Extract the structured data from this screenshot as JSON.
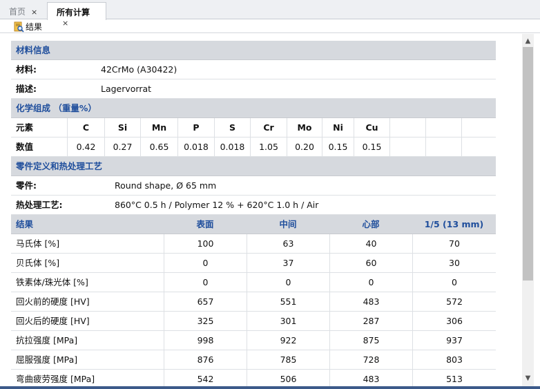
{
  "tabs": [
    {
      "label": "首页",
      "close": "×"
    },
    {
      "label": "所有计算",
      "close": "×"
    }
  ],
  "toolbar": {
    "result_label": "结果"
  },
  "material_section": {
    "title": "材料信息",
    "material_label": "材料:",
    "material_value": "42CrMo (A30422)",
    "desc_label": "描述:",
    "desc_value": "Lagervorrat"
  },
  "chem_section": {
    "title": "化学组成 （重量%）",
    "row1_label": "元素",
    "row2_label": "数值",
    "elements": [
      "C",
      "Si",
      "Mn",
      "P",
      "S",
      "Cr",
      "Mo",
      "Ni",
      "Cu"
    ],
    "values": [
      "0.42",
      "0.27",
      "0.65",
      "0.018",
      "0.018",
      "1.05",
      "0.20",
      "0.15",
      "0.15"
    ]
  },
  "part_section": {
    "title": "零件定义和热处理工艺",
    "part_label": "零件:",
    "part_value": "Round shape, Ø 65 mm",
    "heat_label": "热处理工艺:",
    "heat_value": "860°C 0.5 h / Polymer 12 % + 620°C 1.0 h / Air"
  },
  "results": {
    "title": "结果",
    "columns": [
      "表面",
      "中间",
      "心部",
      "1/5 (13 mm)"
    ],
    "rows": [
      {
        "label": "马氏体 [%]",
        "values": [
          "100",
          "63",
          "40",
          "70"
        ]
      },
      {
        "label": "贝氏体 [%]",
        "values": [
          "0",
          "37",
          "60",
          "30"
        ]
      },
      {
        "label": "铁素体/珠光体 [%]",
        "values": [
          "0",
          "0",
          "0",
          "0"
        ]
      },
      {
        "label": "回火前的硬度 [HV]",
        "values": [
          "657",
          "551",
          "483",
          "572"
        ]
      },
      {
        "label": "回火后的硬度 [HV]",
        "values": [
          "325",
          "301",
          "287",
          "306"
        ]
      },
      {
        "label": "抗拉强度 [MPa]",
        "values": [
          "998",
          "922",
          "875",
          "937"
        ]
      },
      {
        "label": "屈服强度 [MPa]",
        "values": [
          "876",
          "785",
          "728",
          "803"
        ]
      },
      {
        "label": "弯曲疲劳强度 [MPa]",
        "values": [
          "542",
          "506",
          "483",
          "513"
        ]
      }
    ]
  },
  "colors": {
    "section_bg": "#d6d9de",
    "accent": "#1f4e9c",
    "grid": "#dde0e4"
  },
  "icons": {
    "result_icon": "report-magnifier-icon",
    "scroll_up": "chevron-up-icon",
    "scroll_down": "chevron-down-icon"
  }
}
